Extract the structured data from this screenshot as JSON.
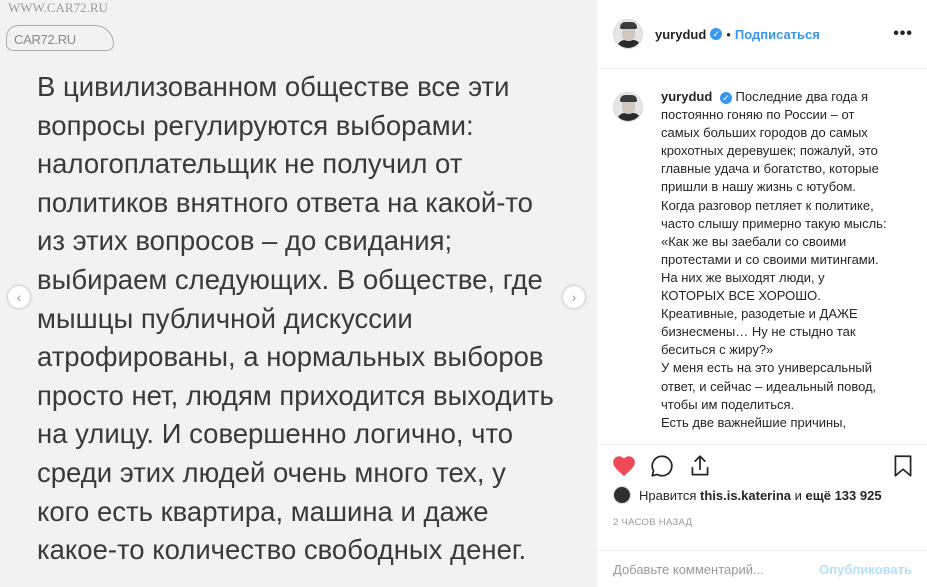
{
  "watermark": {
    "top": "WWW.CAR72.RU",
    "logo": "CAR72.RU"
  },
  "post_image": {
    "text": "В цивилизованном обществе все эти\nвопросы регулируются выборами:\nналогоплательщик не получил от\nполитиков внятного ответа на какой-то\nиз этих вопросов – до свидания;\nвыбираем следующих. В обществе, где\nмышцы публичной дискуссии\nатрофированы, а нормальных выборов\nпросто нет, людям приходится выходить\nна улицу. И совершенно логично, что\nсреди этих людей очень много тех, у\nкого есть квартира, машина и даже\nкакое-то количество свободных денег.",
    "prev_icon": "chevron-left-icon",
    "next_icon": "chevron-right-icon"
  },
  "header": {
    "username": "yurydud",
    "verified_icon": "verified-badge-icon",
    "separator": "•",
    "follow_label": "Подписаться",
    "more_label": "•••"
  },
  "caption": {
    "username": "yurydud",
    "text": "Последние два года я постоянно гоняю по России – от самых больших городов до самых крохотных деревушек; пожалуй, это главные удача и богатство, которые пришли в нашу жизнь с ютубом. Когда разговор петляет к политике, часто слышу примерно такую мысль: «Как же вы заебали со своими протестами и со своими митингами. На них же выходят люди, у КОТОРЫХ ВСЕ ХОРОШО. Креативные, разодетые и ДАЖЕ бизнесмены… Ну не стыдно так беситься с жиру?»\nУ меня есть на это универсальный ответ, и сейчас – идеальный повод, чтобы им поделиться.\nЕсть две важнейшие причины,"
  },
  "actions": {
    "like_icon": "heart-filled-icon",
    "comment_icon": "comment-icon",
    "share_icon": "share-icon",
    "save_icon": "bookmark-icon",
    "like_color": "#ed4956"
  },
  "likes": {
    "prefix": "Нравится ",
    "liker": "this.is.katerina",
    "middle": " и ",
    "count": "ещё 133 925"
  },
  "timestamp": "2 ЧАСОВ НАЗАД",
  "comment": {
    "placeholder": "Добавьте комментарий...",
    "publish_label": "Опубликовать"
  },
  "colors": {
    "accent": "#3897f0",
    "publish_disabled": "#b2dffc"
  }
}
